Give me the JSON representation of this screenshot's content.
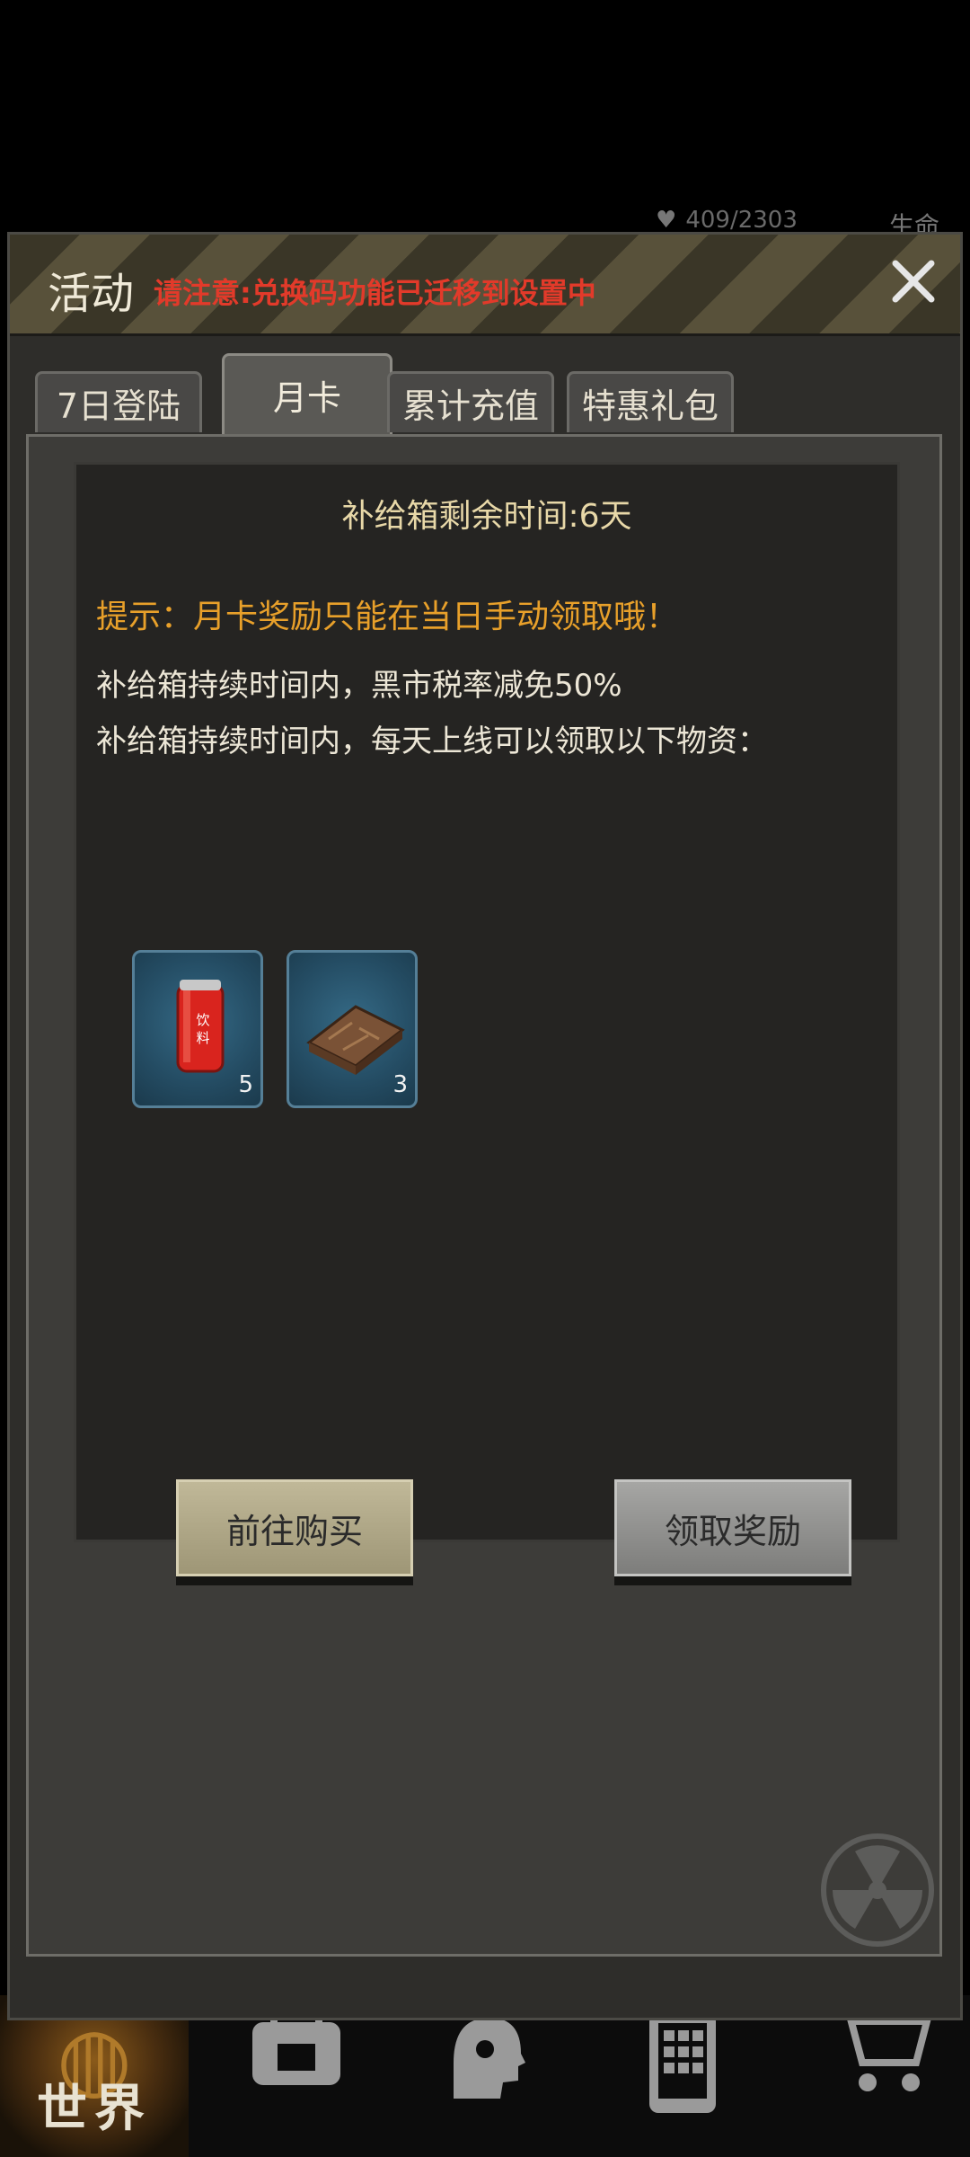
{
  "background": {
    "status_counter": "409/2303",
    "life_label": "生命"
  },
  "bottom_nav": {
    "world_label": "世界",
    "icons": [
      "backpack-icon",
      "head-icon",
      "phone-icon",
      "cart-icon"
    ]
  },
  "dialog": {
    "title": "活动",
    "notice": "请注意:兑换码功能已迁移到设置中",
    "tabs": [
      {
        "label": "7日登陆",
        "active": false
      },
      {
        "label": "月卡",
        "active": true
      },
      {
        "label": "累计充值",
        "active": false
      },
      {
        "label": "特惠礼包",
        "active": false
      }
    ],
    "monthly_card": {
      "remaining": "补给箱剩余时间:6天",
      "tip": "提示：月卡奖励只能在当日手动领取哦！",
      "desc_1": "补给箱持续时间内，黑市税率减免50%",
      "desc_2": "补给箱持续时间内，每天上线可以领取以下物资：",
      "items": [
        {
          "icon": "drink-can-icon",
          "can_text": "饮料",
          "quantity": "5"
        },
        {
          "icon": "supply-box-icon",
          "quantity": "3"
        }
      ]
    },
    "buttons": {
      "buy": "前往购买",
      "claim": "领取奖励"
    }
  },
  "colors": {
    "notice_red": "#e23a2a",
    "tip_orange": "#e8a02a",
    "item_blue": "#244c63"
  }
}
